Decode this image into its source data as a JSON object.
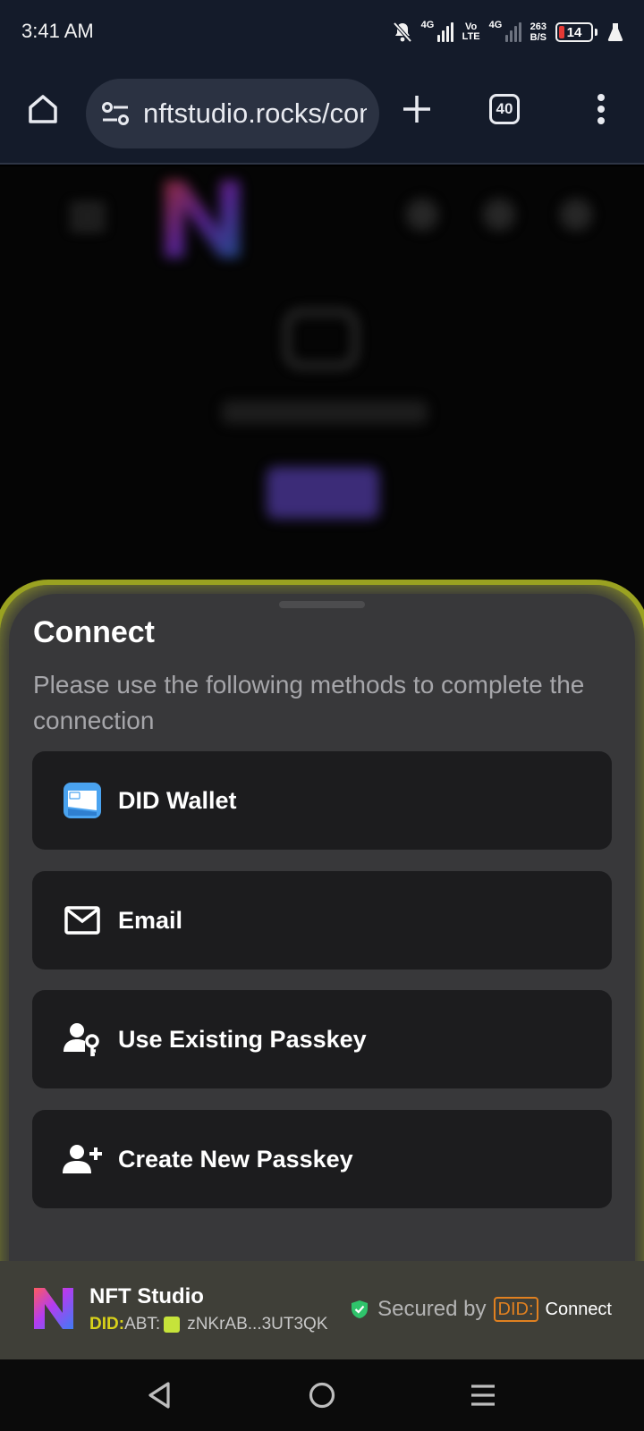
{
  "status_bar": {
    "time": "3:41 AM",
    "signal1_label": "4G",
    "volte_top": "Vo",
    "volte_bottom": "LTE",
    "signal2_label": "4G",
    "net_speed_value": "263",
    "net_speed_unit": "B/S",
    "battery_level": "14",
    "battery_color": "#e53935"
  },
  "browser": {
    "url": "nftstudio.rocks/connect",
    "tab_count": "40",
    "icons": [
      "home-icon",
      "site-settings-icon",
      "new-tab-icon",
      "tab-switcher-icon",
      "more-options-icon"
    ]
  },
  "sheet": {
    "title": "Connect",
    "subtitle": "Please use the following methods to complete the connection",
    "methods": [
      {
        "label": "DID Wallet",
        "icon": "did-wallet-icon"
      },
      {
        "label": "Email",
        "icon": "email-icon"
      },
      {
        "label": "Use Existing Passkey",
        "icon": "passkey-icon"
      },
      {
        "label": "Create New Passkey",
        "icon": "add-user-icon"
      }
    ],
    "footer": {
      "app_name": "NFT Studio",
      "did_prefix": "DID:",
      "did_type": "ABT:",
      "did_value": "zNKrAB...3UT3QK",
      "secured_by": "Secured by",
      "did_badge": "DID:",
      "connect_label": "Connect",
      "accent": "#9aa221"
    }
  },
  "nav": {
    "icons": [
      "back-icon",
      "home-circle-icon",
      "recents-icon"
    ]
  }
}
